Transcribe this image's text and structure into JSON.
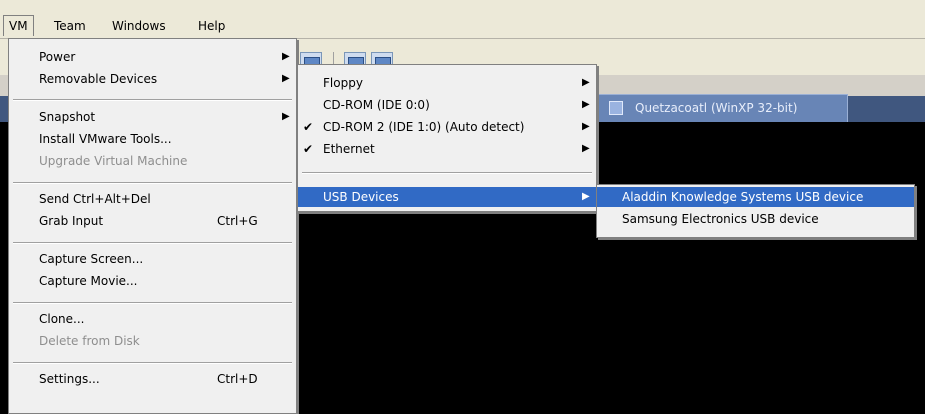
{
  "menubar": {
    "items": [
      {
        "label": "VM"
      },
      {
        "label": "Team"
      },
      {
        "label": "Windows"
      },
      {
        "label": "Help"
      }
    ]
  },
  "tab": {
    "label": "Quetzacoatl (WinXP 32-bit)"
  },
  "vm_menu": {
    "items": [
      {
        "label": "Power",
        "shortcut": ""
      },
      {
        "label": "Removable Devices",
        "shortcut": ""
      },
      {
        "label": "Snapshot",
        "shortcut": ""
      },
      {
        "label": "Install VMware Tools...",
        "shortcut": ""
      },
      {
        "label": "Upgrade Virtual Machine",
        "shortcut": ""
      },
      {
        "label": "Send Ctrl+Alt+Del",
        "shortcut": ""
      },
      {
        "label": "Grab Input",
        "shortcut": "Ctrl+G"
      },
      {
        "label": "Capture Screen...",
        "shortcut": ""
      },
      {
        "label": "Capture Movie...",
        "shortcut": ""
      },
      {
        "label": "Clone...",
        "shortcut": ""
      },
      {
        "label": "Delete from Disk",
        "shortcut": ""
      },
      {
        "label": "Settings...",
        "shortcut": "Ctrl+D"
      }
    ]
  },
  "removable_menu": {
    "items": [
      {
        "label": "Floppy"
      },
      {
        "label": "CD-ROM (IDE 0:0)"
      },
      {
        "label": "CD-ROM 2 (IDE 1:0) (Auto detect)"
      },
      {
        "label": "Ethernet"
      },
      {
        "label": "USB Devices"
      }
    ]
  },
  "usb_menu": {
    "items": [
      {
        "label": "Aladdin Knowledge Systems USB device"
      },
      {
        "label": "Samsung Electronics USB device"
      }
    ]
  },
  "colors": {
    "highlight": "#316ac5",
    "console": "#000000",
    "menu_bg": "#f0f0f0",
    "tab_bg": "#6885b6"
  }
}
